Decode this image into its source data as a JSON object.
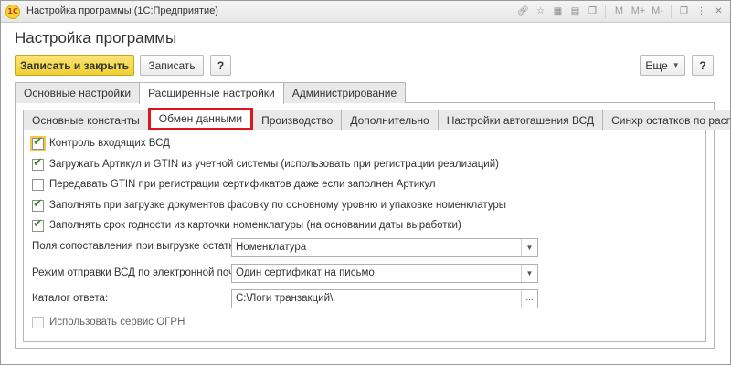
{
  "window": {
    "title": "Настройка программы  (1С:Предприятие)",
    "logo_text": "1С",
    "title_icons": [
      "link-icon",
      "star-icon",
      "calendar-icon",
      "calculator-icon",
      "copy-icon"
    ],
    "title_text_buttons": [
      "M",
      "M+",
      "M-"
    ],
    "title_controls": [
      "restore-icon",
      "menu-icon",
      "close-icon"
    ]
  },
  "page_title": "Настройка программы",
  "toolbar": {
    "save_close_label": "Записать и закрыть",
    "save_label": "Записать",
    "help_label": "?",
    "more_label": "Еще",
    "help_right_label": "?"
  },
  "tabs_top": [
    {
      "label": "Основные настройки",
      "active": false
    },
    {
      "label": "Расширенные настройки",
      "active": true
    },
    {
      "label": "Администрирование",
      "active": false
    }
  ],
  "tabs_inner": [
    {
      "label": "Основные константы",
      "active": false
    },
    {
      "label": "Обмен данными",
      "active": true
    },
    {
      "label": "Производство",
      "active": false
    },
    {
      "label": "Дополнительно",
      "active": false
    },
    {
      "label": "Настройки автогашения ВСД",
      "active": false
    },
    {
      "label": "Синхр остатков по расписанию",
      "active": false
    }
  ],
  "checkboxes": [
    {
      "label": "Контроль входящих ВСД",
      "checked": true
    },
    {
      "label": "Загружать Артикул и GTIN из учетной системы (использовать при регистрации реализаций)",
      "checked": true
    },
    {
      "label": "Передавать GTIN при регистрации сертификатов даже если заполнен Артикул",
      "checked": false
    },
    {
      "label": "Заполнять при загрузке документов фасовку по основному уровню и упаковке номенклатуры",
      "checked": true
    },
    {
      "label": "Заполнять срок годности из карточки номенклатуры (на основании даты выработки)",
      "checked": true
    },
    {
      "label": "Использовать сервис ОГРН",
      "checked": false
    }
  ],
  "fields": {
    "match_fields": {
      "label": "Поля сопоставления при выгрузке остатков:",
      "value": "Номенклатура"
    },
    "send_mode": {
      "label": "Режим отправки ВСД по электронной почте:",
      "value": "Один сертификат на письмо"
    },
    "reply_dir": {
      "label": "Каталог ответа:",
      "value": "C:\\Логи транзакций\\"
    }
  },
  "colors": {
    "primary_button": "#f0cf34",
    "highlight_border": "#e0141e",
    "check": "#3b8a2e"
  }
}
